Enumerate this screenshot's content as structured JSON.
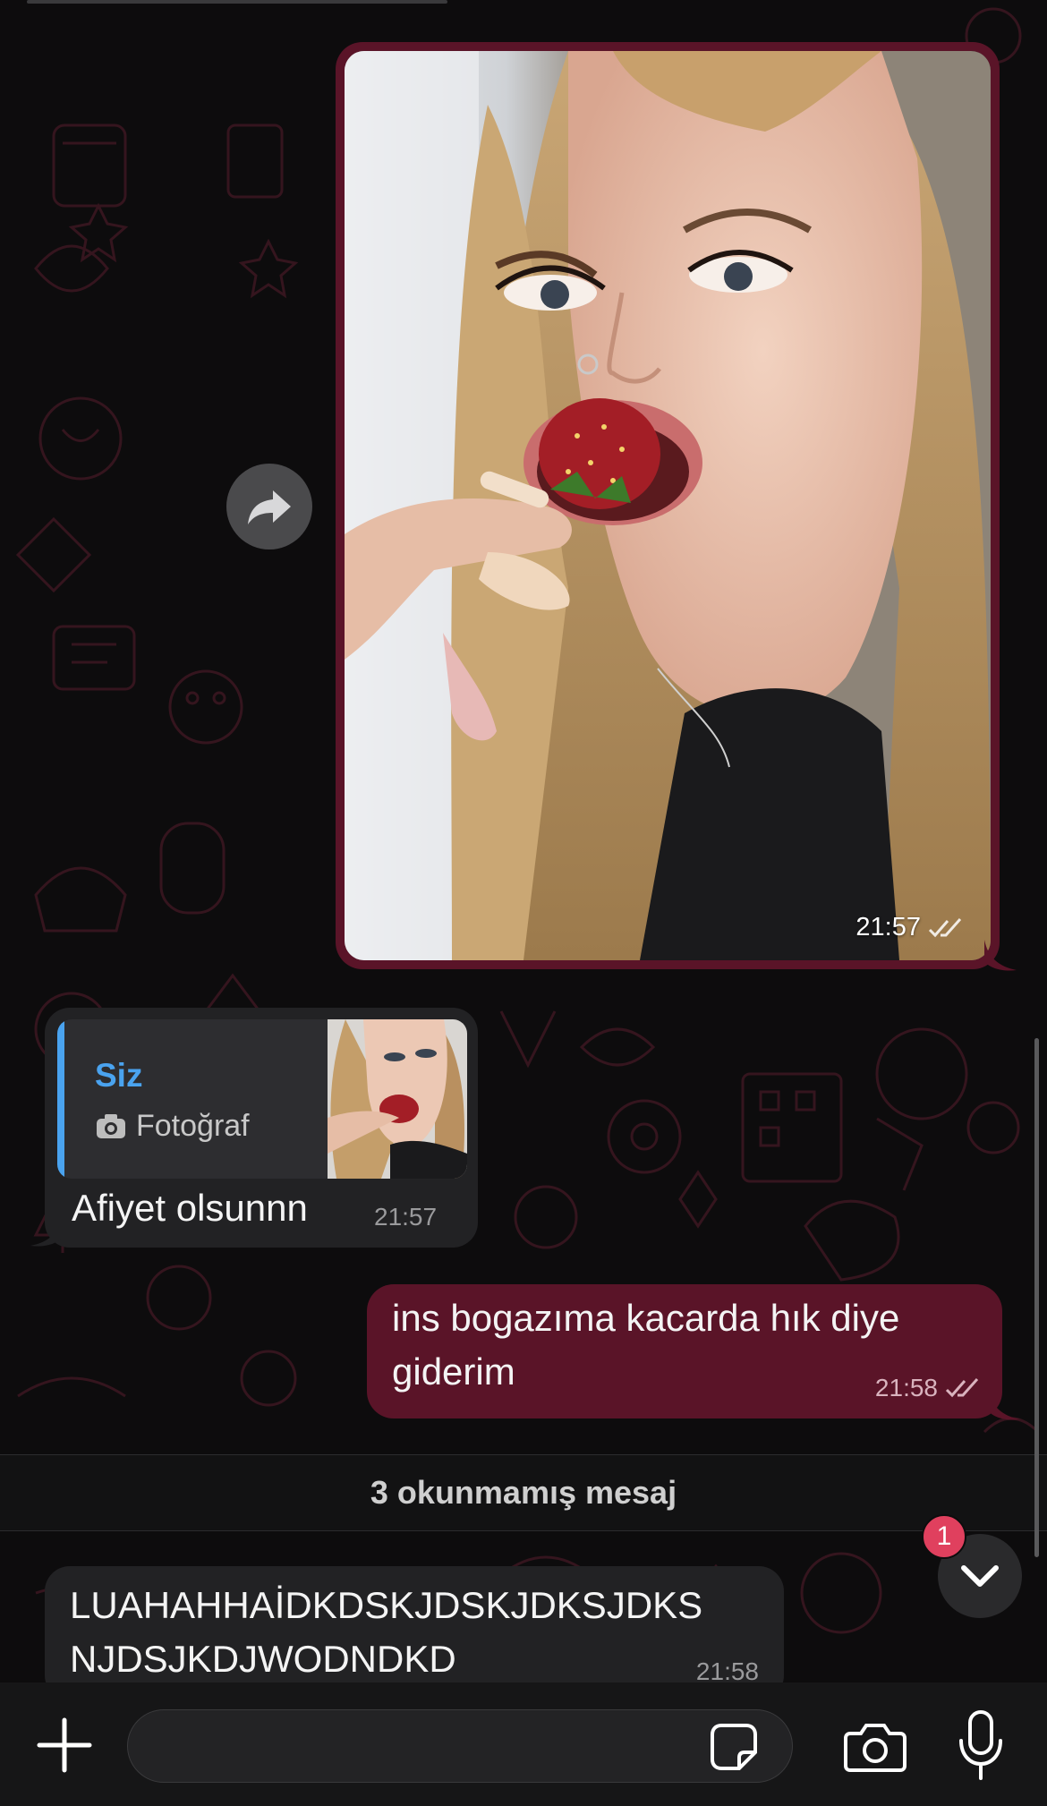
{
  "theme": {
    "outgoing_color": "#5a1428",
    "incoming_color": "#222224",
    "accent": "#4aa3ef",
    "badge_color": "#e0405e"
  },
  "messages": {
    "photo_message": {
      "time": "21:57",
      "status_icon": "double-check-icon"
    },
    "reply_message": {
      "quoted_name": "Siz",
      "quoted_type_icon": "camera-icon",
      "quoted_type": "Fotoğraf",
      "text": "Afiyet olsunnn",
      "time": "21:57"
    },
    "outgoing_text": {
      "line1": "ins bogazıma kacarda hık diye",
      "line2": "giderim",
      "time": "21:58",
      "status_icon": "double-check-icon"
    },
    "unread_divider": "3 okunmamış mesaj",
    "incoming_text": {
      "line1": "LUAHAHHAİDKDSKJDSKJDKSJDKS",
      "line2": "NJDSJKDJWODNDKD",
      "time": "21:58"
    }
  },
  "scroll_button": {
    "badge": "1",
    "icon": "chevron-down-icon"
  },
  "composer": {
    "placeholder": "",
    "icons": [
      "plus-icon",
      "sticker-icon",
      "camera-icon",
      "microphone-icon"
    ]
  }
}
